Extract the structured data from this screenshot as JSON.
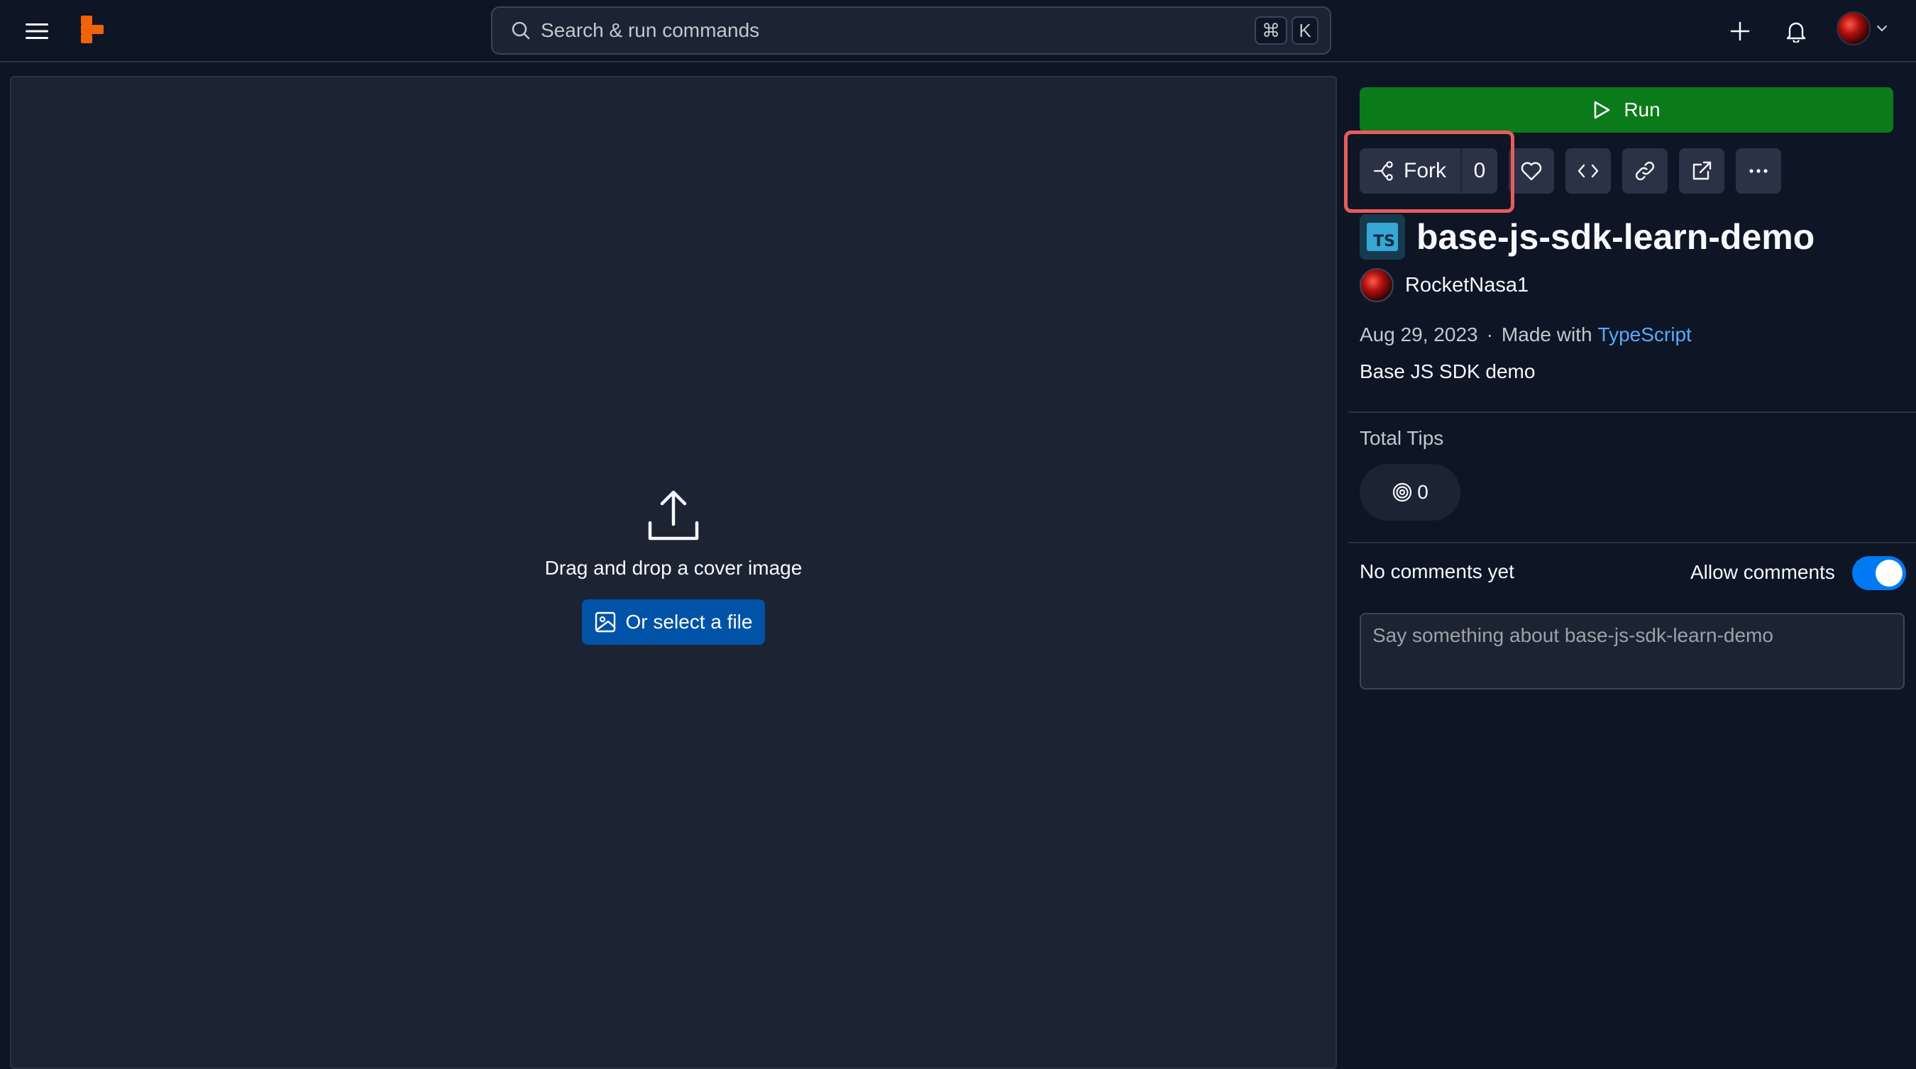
{
  "header": {
    "search_placeholder": "Search & run commands",
    "shortcut_keys": [
      "⌘",
      "K"
    ]
  },
  "cover": {
    "drop_text": "Drag and drop a cover image",
    "select_label": "Or select a file"
  },
  "panel": {
    "run_label": "Run",
    "fork_label": "Fork",
    "fork_count": "0",
    "title": "base-js-sdk-learn-demo",
    "language_badge": "TS",
    "author": "RocketNasa1",
    "date": "Aug 29, 2023",
    "separator": "·",
    "made_with": "Made with",
    "language": "TypeScript",
    "description": "Base JS SDK demo",
    "tips_label": "Total Tips",
    "tips_count": "0",
    "no_comments": "No comments yet",
    "allow_comments_label": "Allow comments",
    "allow_comments_enabled": true,
    "comment_placeholder": "Say something about base-js-sdk-learn-demo"
  },
  "colors": {
    "background": "#0e1525",
    "surface": "#1c2333",
    "run_green": "#0b7a1b",
    "primary_blue": "#0053a6",
    "link_blue": "#57abff",
    "toggle_blue": "#0079f2",
    "logo_orange": "#f26207",
    "highlight_red": "#e85c5c"
  },
  "icons": [
    "menu-icon",
    "replit-logo",
    "search-icon",
    "plus-icon",
    "bell-icon",
    "chevron-down-icon",
    "upload-icon",
    "image-icon",
    "play-icon",
    "fork-icon",
    "heart-icon",
    "code-icon",
    "link-icon",
    "external-link-icon",
    "more-icon",
    "cycles-icon"
  ]
}
